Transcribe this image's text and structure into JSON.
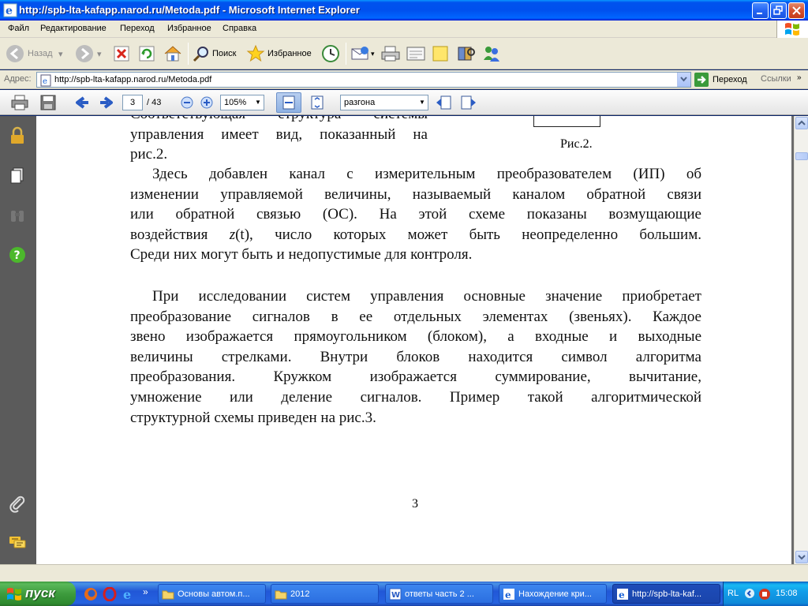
{
  "window": {
    "title": "http://spb-lta-kafapp.narod.ru/Metoda.pdf - Microsoft Internet Explorer"
  },
  "menu": [
    "Файл",
    "Редактирование",
    "Переход",
    "Избранное",
    "Справка"
  ],
  "toolbar": {
    "back_label": "Назад",
    "search_label": "Поиск",
    "favorites_label": "Избранное"
  },
  "address": {
    "label": "Адрес:",
    "url": "http://spb-lta-kafapp.narod.ru/Metoda.pdf",
    "go_label": "Переход",
    "links_label": "Ссылки"
  },
  "pdf_toolbar": {
    "current_page": "3",
    "total_pages": "/ 43",
    "zoom": "105%",
    "find_text": "разгона"
  },
  "document": {
    "top_lines": [
      "Соответствующая структура системы",
      "управления имеет вид, показанный на",
      "рис.2."
    ],
    "figure_caption": "Рис.2.",
    "para1_lines": [
      "Здесь добавлен канал с измерительным преобразователем (ИП) об",
      "изменении управляемой величины, называемый каналом обратной связи",
      "или обратной связью (ОС). На этой схеме показаны возмущающие",
      "воздействия z(t), число которых может быть неопределенно большим.",
      "Среди них могут быть и недопустимые для контроля."
    ],
    "para1_l4_a": "воздействия ",
    "para1_l4_z": "z",
    "para1_l4_b": "(t), число которых может быть неопределенно большим.",
    "para2_lines": [
      "При исследовании систем управления основные значение приобретает",
      "преобразование сигналов в ее отдельных элементах (звеньях). Каждое",
      "звено изображается прямоугольником (блоком), а входные и выходные",
      "величины стрелками. Внутри блоков находится символ алгоритма",
      "преобразования. Кружком изображается суммирование, вычитание,",
      "умножение или деление сигналов. Пример такой алгоритмической",
      "структурной схемы приведен на рис.3."
    ],
    "page_number": "3"
  },
  "taskbar": {
    "start_label": "пуск",
    "tasks": [
      {
        "label": "Основы автом.п...",
        "icon": "folder-icon"
      },
      {
        "label": "2012",
        "icon": "folder-icon"
      },
      {
        "label": "ответы часть 2 ...",
        "icon": "word-icon"
      },
      {
        "label": "Нахождение кри...",
        "icon": "ie-icon"
      },
      {
        "label": "http://spb-lta-kaf...",
        "icon": "ie-icon"
      }
    ],
    "lang": "RL",
    "clock": "15:08"
  },
  "colors": {
    "titlebar": "#0053ee",
    "chrome": "#ece9d8",
    "left_panel": "#5b5b5b",
    "taskbar": "#245edb",
    "start": "#3d9b3d"
  }
}
